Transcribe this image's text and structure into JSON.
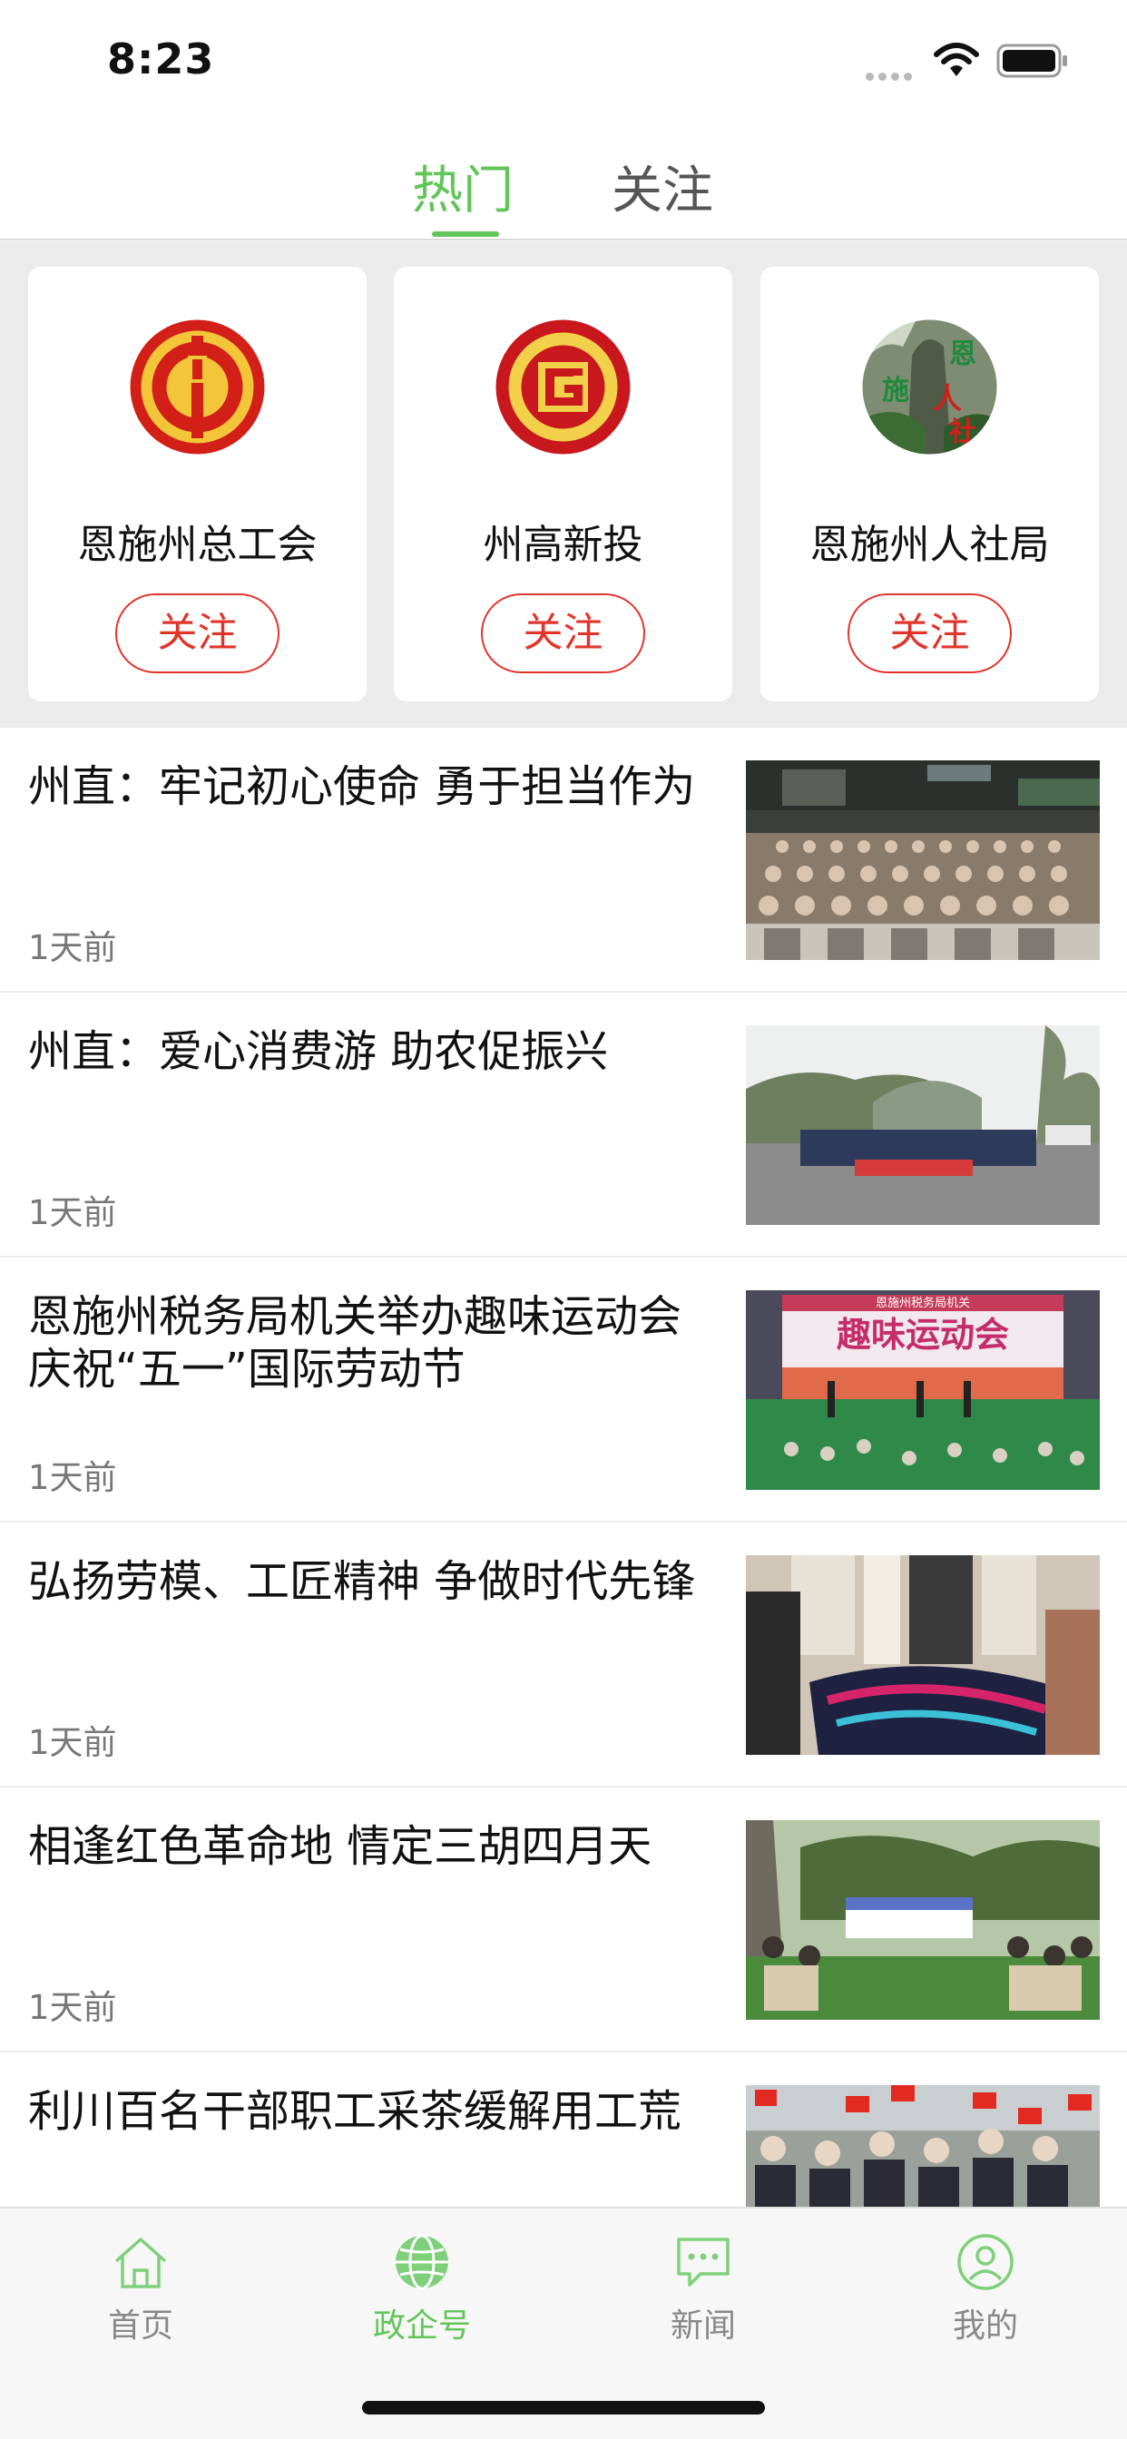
{
  "status_bar": {
    "time": "8:23"
  },
  "top_tabs": [
    {
      "label": "热门",
      "active": true
    },
    {
      "label": "关注",
      "active": false
    }
  ],
  "accounts": [
    {
      "name": "恩施州总工会",
      "follow_label": "关注",
      "logo": "union-emblem-icon"
    },
    {
      "name": "州高新投",
      "follow_label": "关注",
      "logo": "hitech-investment-logo-icon"
    },
    {
      "name": "恩施州人社局",
      "follow_label": "关注",
      "logo": "hr-bureau-logo-icon",
      "logo_text": "恩施人社"
    }
  ],
  "news": [
    {
      "title": "州直：牢记初心使命 勇于担当作为",
      "time": "1天前",
      "thumb": "auditorium-photo"
    },
    {
      "title": "州直：爱心消费游 助农促振兴",
      "time": "1天前",
      "thumb": "group-photo-outdoor"
    },
    {
      "title": "恩施州税务局机关举办趣味运动会庆祝“五一”国际劳动节",
      "time": "1天前",
      "thumb": "sports-meeting-photo",
      "thumb_text": {
        "banner_small": "恩施州税务局机关",
        "banner_large": "趣味运动会"
      }
    },
    {
      "title": "弘扬劳模、工匠精神 争做时代先锋",
      "time": "1天前",
      "thumb": "embroidery-display-photo"
    },
    {
      "title": "相逢红色革命地 情定三胡四月天",
      "time": "1天前",
      "thumb": "outdoor-wedding-photo"
    },
    {
      "title": "利川百名干部职工采茶缓解用工荒",
      "time": "",
      "thumb": "crowd-flags-photo"
    }
  ],
  "bottom_nav": [
    {
      "label": "首页",
      "icon": "home-icon",
      "active": false
    },
    {
      "label": "政企号",
      "icon": "globe-icon",
      "active": true
    },
    {
      "label": "新闻",
      "icon": "message-icon",
      "active": false
    },
    {
      "label": "我的",
      "icon": "profile-icon",
      "active": false
    }
  ],
  "colors": {
    "accent": "#62c55a",
    "follow_red": "#e0352b",
    "divider_gray": "#ebebeb"
  }
}
